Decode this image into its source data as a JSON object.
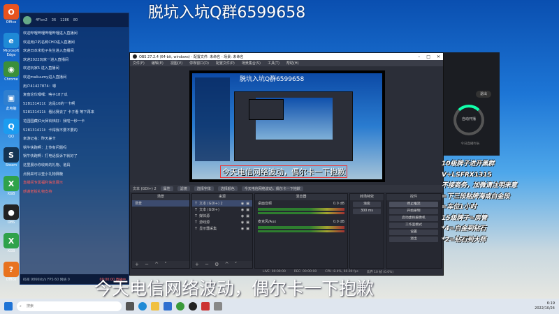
{
  "watermark": "脱坑入坑Q群6599658",
  "desktop_icons": [
    {
      "label": "Office",
      "color": "#e8531f",
      "glyph": "O"
    },
    {
      "label": "Microsoft Edge",
      "color": "#1f8ad6",
      "glyph": "e"
    },
    {
      "label": "Chrome",
      "color": "#3a8f3a",
      "glyph": "◉"
    },
    {
      "label": "此电脑",
      "color": "#2f7fd0",
      "glyph": "▣"
    },
    {
      "label": "QQ",
      "color": "#1c9cf0",
      "glyph": "Q"
    },
    {
      "label": "Steam",
      "color": "#143453",
      "glyph": "S"
    },
    {
      "label": "XGB",
      "color": "#2fa24a",
      "glyph": "X"
    },
    {
      "label": "OBS",
      "color": "#222",
      "glyph": "●"
    },
    {
      "label": "XGB",
      "color": "#2fa24a",
      "glyph": "X"
    },
    {
      "label": "Office",
      "color": "#e8731f",
      "glyph": "?"
    }
  ],
  "chat": {
    "stats": [
      "4Flvn2",
      "36",
      "1286",
      "80"
    ],
    "messages": [
      {
        "text": "欢迎哔哩哔哩哔哩哔哩进入直播间",
        "red": false
      },
      {
        "text": "欢迎用户的名称CHO进入直播间",
        "red": false
      },
      {
        "text": "欢迎日本米粒子先生进入直播间",
        "red": false
      },
      {
        "text": "欢迎2022玩家一进入直播间",
        "red": false
      },
      {
        "text": "欢迎玩家5 进入直播间",
        "red": false
      },
      {
        "text": "欢迎maliuumy进入直播间",
        "red": false
      },
      {
        "text": "用户41427874：嗯",
        "red": false
      },
      {
        "text": "复盘论伙嘿嘿：啥子18了瓜",
        "red": false
      },
      {
        "text": "528131411I：这是10的一卡啊",
        "red": false
      },
      {
        "text": "528131411I：看比赛去了 卡子看 等下再来",
        "red": false
      },
      {
        "text": "花园园藏红大师铃铛好：我啦一秒一卡",
        "red": false
      },
      {
        "text": "528131411I：卡得我不要不要的",
        "red": false
      },
      {
        "text": "幸游记名：昨天差卡",
        "red": false
      },
      {
        "text": "锅牛快跑啊：上传有问题吗",
        "red": false
      },
      {
        "text": "锅牛快跑啊：打电话投诉下就好了",
        "red": false
      },
      {
        "text": "这里展示你收到的礼物、道具",
        "red": false
      },
      {
        "text": "点我来可以查小礼物屏蔽",
        "red": false
      },
      {
        "text": "直播间专属福利信息展示",
        "red": true
      },
      {
        "text": "感谢老板礼物支持",
        "red": true
      }
    ],
    "footer_left": "码率 9866kb/s  FPS 60  网络 0",
    "footer_right": "00:00:00  直播中"
  },
  "obs": {
    "title": "OBS 27.2.4 (64-bit, windows) - 配置文件: 未命名 - 场景: 未命名",
    "menu": [
      "文件(F)",
      "编辑(E)",
      "视图(V)",
      "停靠窗口(D)",
      "配置文件(P)",
      "场景集合(S)",
      "工具(T)",
      "帮助(H)"
    ],
    "preview_watermark": "脱坑入坑Q群6599658",
    "preview_caption": "今天电信网络波动，偶尔卡一下抱歉",
    "scene_bar": {
      "label": "文本 (GDI+) 2",
      "buttons": [
        "属性",
        "滤镜",
        "选择字体",
        "选择颜色"
      ],
      "text_preview": "今天电信网络波动，偶尔卡一下抱歉"
    },
    "docks": {
      "scenes": {
        "title": "场景",
        "items": [
          "场景"
        ]
      },
      "sources": {
        "title": "来源",
        "items": [
          "文本 (GDI+) 2",
          "文本 (GDI+)",
          "媒体源",
          "游戏源",
          "显示器采集"
        ]
      },
      "mixer": {
        "title": "混音器",
        "channels": [
          {
            "name": "桌面音频",
            "db": "0.0 dB"
          },
          {
            "name": "麦克风/Aux",
            "db": "0.0 dB"
          }
        ]
      },
      "transitions": {
        "title": "转场特效",
        "type": "渐变",
        "duration": "300 ms"
      },
      "controls": {
        "title": "控件",
        "buttons": [
          "停止推流",
          "开始录制",
          "启动虚拟摄像机",
          "工作室模式",
          "设置",
          "退出"
        ]
      }
    },
    "status": [
      "LIVE: 00:00:00",
      "REC: 00:00:00",
      "CPU: 8.4%, 60.00 fps",
      "丢弃 10 帧 (0.0%)"
    ]
  },
  "right_app": {
    "button": "退出",
    "ring_label": "自动开播",
    "subtext": "今日直播时长"
  },
  "rank_lines": [
    "10级牌子进开黑群",
    "V+LSFRX1315",
    "不接商务，加微请注明来意",
    "=下三段粘牌海或白金段",
    "=车位1小时",
    "15级牌子=房管",
    "*4=白金到钻石",
    "*2=钻石到大师"
  ],
  "big_caption": "今天电信网络波动，偶尔卡一下抱歉",
  "taskbar": {
    "search_placeholder": "搜索",
    "time": "6:19",
    "date": "2022/10/24"
  }
}
